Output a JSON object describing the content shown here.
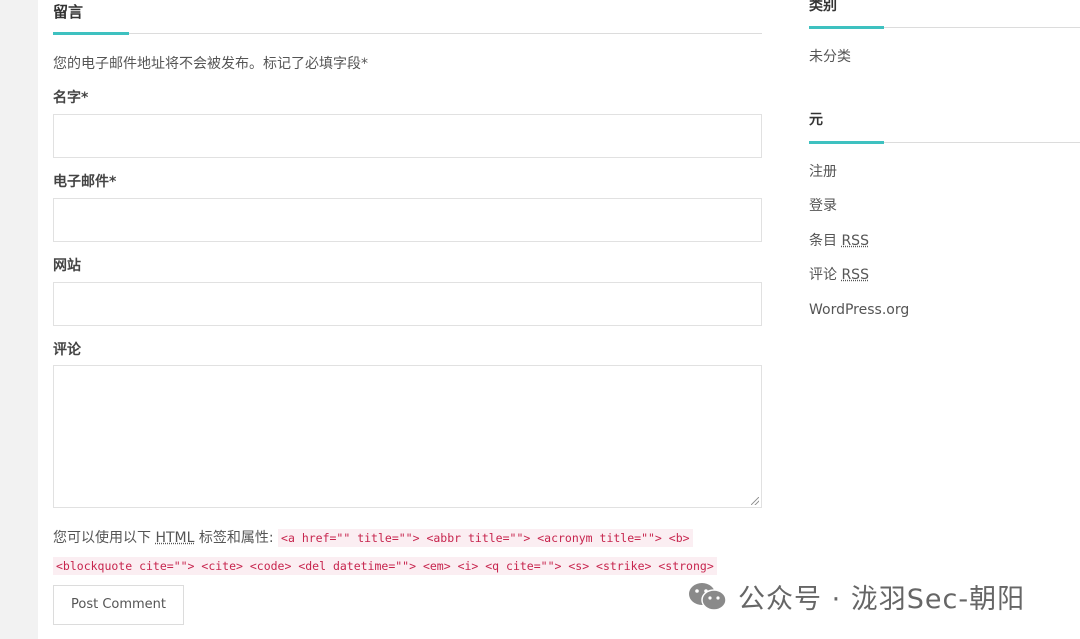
{
  "comment_form": {
    "title": "留言",
    "notice": "您的电子邮件地址将不会被发布。标记了必填字段*",
    "fields": {
      "name_label": "名字*",
      "email_label": "电子邮件*",
      "website_label": "网站",
      "comment_label": "评论"
    },
    "allowed_tags_prefix": "您可以使用以下",
    "allowed_tags_abbr": "HTML",
    "allowed_tags_suffix": "标签和属性:",
    "allowed_tags_line1": "<a href=\"\" title=\"\"> <abbr title=\"\"> <acronym title=\"\"> <b>",
    "allowed_tags_line2": "<blockquote cite=\"\"> <cite> <code> <del datetime=\"\"> <em> <i> <q cite=\"\"> <s> <strike> <strong>",
    "submit_label": "Post Comment"
  },
  "sidebar": {
    "categories": {
      "title": "类别",
      "items": [
        "未分类"
      ]
    },
    "meta": {
      "title": "元",
      "register": "注册",
      "login": "登录",
      "entries_prefix": "条目",
      "comments_prefix": "评论",
      "rss": "RSS",
      "wordpress": "WordPress.org"
    }
  },
  "watermark": {
    "text": "公众号 · 泷羽Sec-朝阳",
    "icon": "wechat-icon"
  }
}
